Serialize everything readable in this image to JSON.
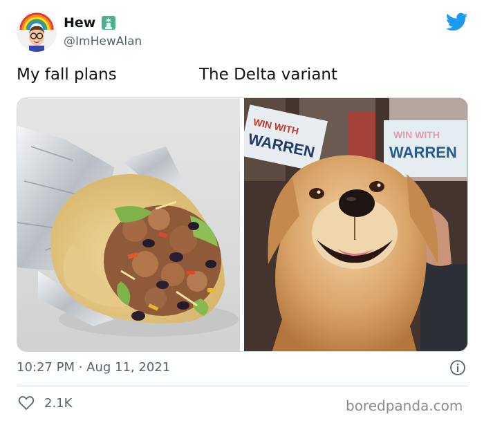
{
  "tweet": {
    "display_name": "Hew",
    "handle": "@ImHewAlan",
    "caption_left": "My fall plans",
    "caption_right": "The Delta variant",
    "timestamp": "10:27 PM · Aug 11, 2021",
    "like_count": "2.1K"
  },
  "images": {
    "left": {
      "sign_text": ""
    },
    "right": {
      "sign_text_1": "WIN WITH",
      "sign_text_2": "WARREN"
    }
  },
  "watermark": "boredpanda.com",
  "icons": {
    "avatar": "bitmoji-avatar-with-rainbow",
    "flag": "statue-of-liberty-icon",
    "brand": "twitter-bird-icon",
    "info": "info-icon",
    "like": "heart-icon"
  },
  "colors": {
    "twitter_blue": "#1d9bf0",
    "secondary_text": "#536471",
    "primary_text": "#0f1419"
  }
}
